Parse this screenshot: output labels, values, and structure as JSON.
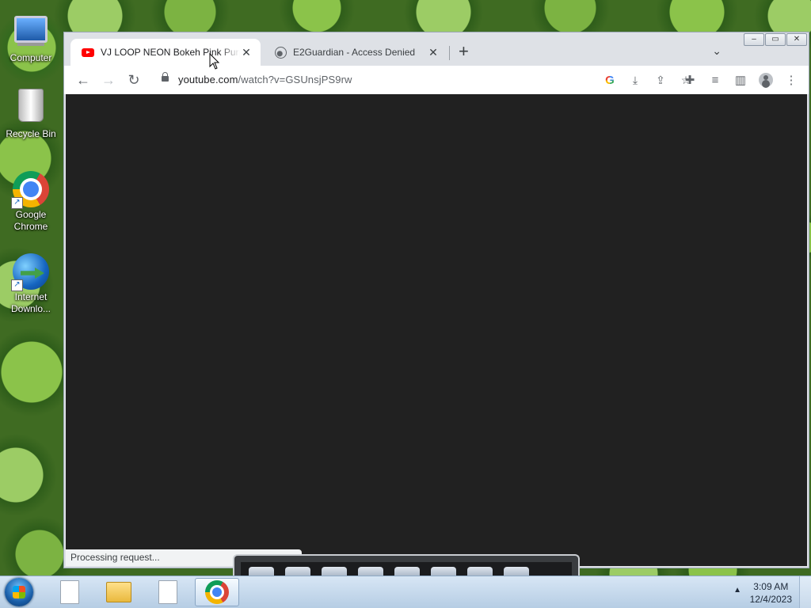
{
  "desktop": {
    "icons": [
      {
        "label": "Computer"
      },
      {
        "label": "Recycle Bin"
      },
      {
        "label": "Google Chrome"
      },
      {
        "label": "Internet Downlo..."
      }
    ]
  },
  "browser": {
    "tabs": [
      {
        "title": "VJ LOOP NEON Bokeh Pink Purple",
        "icon": "youtube-icon",
        "active": true
      },
      {
        "title": "E2Guardian - Access Denied",
        "icon": "globe-icon",
        "active": false
      }
    ],
    "new_tab_label": "+",
    "url_host": "youtube.com",
    "url_path": "/watch?v=GSUnsjPS9rw",
    "status_text": "Processing request..."
  },
  "taskbar": {
    "clock_time": "3:09 AM",
    "clock_date": "12/4/2023"
  },
  "colors": {
    "page_background": "#212121",
    "chrome_frame": "#dee1e6",
    "youtube_red": "#ff0000"
  }
}
